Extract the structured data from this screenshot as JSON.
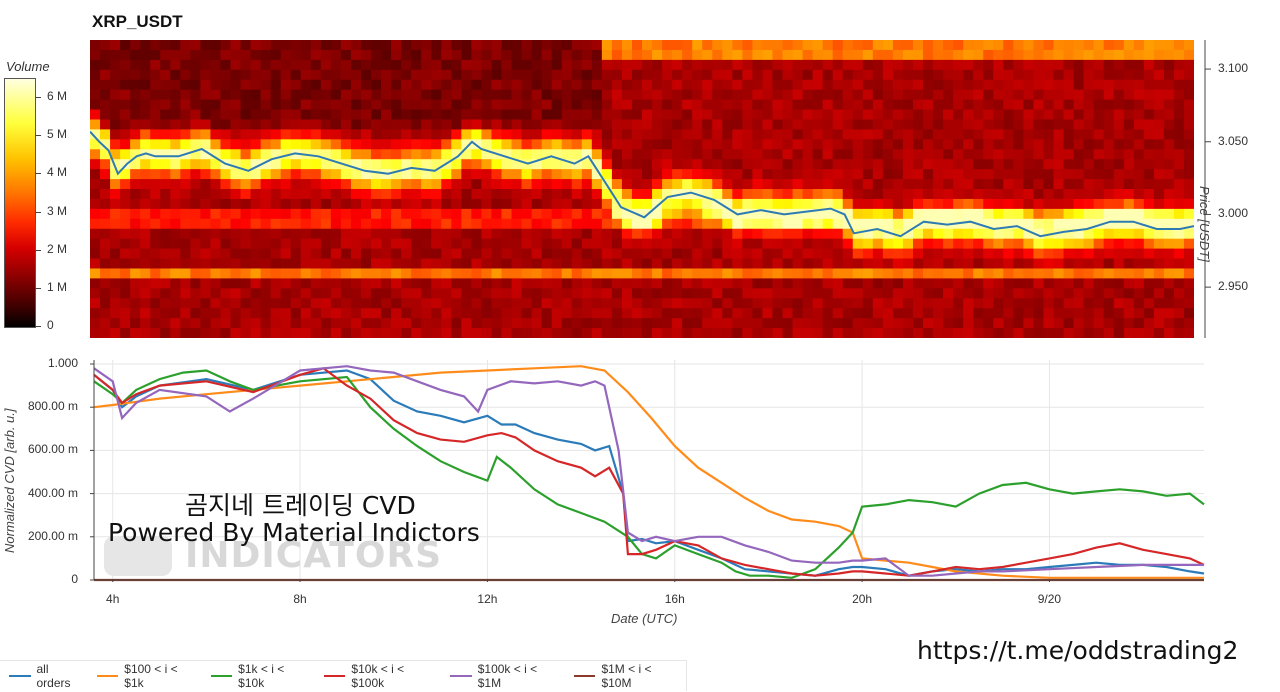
{
  "chart_data": [
    {
      "type": "heatmap",
      "title": "XRP_USDT",
      "colorbar": {
        "label": "Volume",
        "ticks": [
          "0",
          "1 M",
          "2 M",
          "3 M",
          "4 M",
          "5 M",
          "6 M"
        ],
        "range": [
          0,
          6500000
        ],
        "colormap": "hot"
      },
      "ylabel": "Price [USDT]",
      "y_ticks": [
        "2.950",
        "3.000",
        "3.050",
        "3.100"
      ],
      "y_tick_values": [
        2.95,
        3.0,
        3.05,
        3.1
      ],
      "ylim": [
        2.915,
        3.12
      ],
      "x_hours_range": [
        3.6,
        27.3
      ],
      "price_line": {
        "color": "#2e7bb4",
        "x_hours": [
          3.6,
          3.8,
          4.0,
          4.2,
          4.4,
          4.6,
          4.8,
          5.0,
          5.5,
          6.0,
          6.5,
          7.0,
          7.5,
          8.0,
          8.5,
          9.0,
          9.5,
          10.0,
          10.5,
          11.0,
          11.5,
          11.8,
          12.0,
          12.5,
          13.0,
          13.5,
          14.0,
          14.3,
          14.6,
          14.8,
          15.0,
          15.5,
          16.0,
          16.5,
          17.0,
          17.5,
          18.0,
          18.5,
          19.0,
          19.5,
          19.8,
          20.0,
          20.5,
          21.0,
          21.5,
          22.0,
          22.5,
          23.0,
          23.5,
          24.0,
          24.5,
          25.0,
          25.5,
          26.0,
          26.5,
          27.0,
          27.3
        ],
        "price": [
          3.057,
          3.05,
          3.044,
          3.028,
          3.035,
          3.04,
          3.042,
          3.04,
          3.04,
          3.045,
          3.035,
          3.03,
          3.038,
          3.042,
          3.04,
          3.035,
          3.03,
          3.028,
          3.032,
          3.03,
          3.04,
          3.05,
          3.045,
          3.04,
          3.035,
          3.04,
          3.035,
          3.04,
          3.025,
          3.015,
          3.005,
          2.998,
          3.012,
          3.015,
          3.01,
          3.0,
          3.003,
          3.0,
          3.002,
          3.004,
          3.0,
          2.987,
          2.99,
          2.985,
          2.995,
          2.993,
          2.995,
          2.99,
          2.992,
          2.985,
          2.988,
          2.99,
          2.995,
          2.995,
          2.99,
          2.99,
          2.992
        ]
      }
    },
    {
      "type": "line",
      "xlabel": "Date (UTC)",
      "ylabel": "Normalized CVD [arb. u.]",
      "x_ticks": [
        "4h",
        "8h",
        "12h",
        "16h",
        "20h",
        "9/20"
      ],
      "x_tick_hours": [
        4,
        8,
        12,
        16,
        20,
        24
      ],
      "xlim": [
        3.6,
        27.3
      ],
      "y_ticks": [
        "0",
        "200.00 m",
        "400.00 m",
        "600.00 m",
        "800.00 m",
        "1.000"
      ],
      "y_tick_values": [
        0,
        0.2,
        0.4,
        0.6,
        0.8,
        1.0
      ],
      "ylim": [
        0,
        1.0
      ],
      "grid": true,
      "legend_position": "bottom-left",
      "series": [
        {
          "name": "all orders",
          "color": "#2b7bb9",
          "x": [
            3.6,
            4.0,
            4.2,
            4.5,
            5.0,
            6.0,
            7.0,
            8.0,
            9.0,
            9.5,
            10.0,
            10.5,
            11.0,
            11.5,
            12.0,
            12.3,
            12.6,
            13.0,
            13.5,
            14.0,
            14.3,
            14.6,
            14.9,
            15.0,
            15.3,
            15.6,
            16.0,
            16.5,
            17.0,
            17.5,
            18.0,
            18.5,
            19.0,
            19.5,
            19.8,
            20.0,
            20.5,
            21.0,
            21.5,
            22.0,
            22.5,
            23.0,
            23.5,
            24.0,
            24.5,
            25.0,
            25.5,
            26.0,
            26.5,
            27.0,
            27.3
          ],
          "y": [
            0.95,
            0.88,
            0.8,
            0.85,
            0.9,
            0.93,
            0.88,
            0.95,
            0.97,
            0.93,
            0.83,
            0.78,
            0.76,
            0.73,
            0.76,
            0.72,
            0.72,
            0.68,
            0.65,
            0.63,
            0.6,
            0.62,
            0.4,
            0.18,
            0.19,
            0.17,
            0.18,
            0.14,
            0.1,
            0.05,
            0.04,
            0.03,
            0.02,
            0.05,
            0.06,
            0.06,
            0.05,
            0.02,
            0.04,
            0.05,
            0.04,
            0.05,
            0.05,
            0.06,
            0.07,
            0.08,
            0.07,
            0.07,
            0.06,
            0.04,
            0.03
          ]
        },
        {
          "name": "$100 < i < $1k",
          "color": "#ff8c1a",
          "x": [
            3.6,
            4.0,
            5.0,
            6.0,
            7.0,
            8.0,
            9.0,
            10.0,
            11.0,
            12.0,
            13.0,
            14.0,
            14.5,
            15.0,
            15.5,
            16.0,
            16.5,
            17.0,
            17.5,
            18.0,
            18.5,
            19.0,
            19.5,
            19.8,
            20.0,
            20.5,
            21.0,
            21.5,
            22.0,
            23.0,
            24.0,
            25.0,
            26.0,
            27.3
          ],
          "y": [
            0.8,
            0.81,
            0.84,
            0.86,
            0.88,
            0.9,
            0.92,
            0.94,
            0.96,
            0.97,
            0.98,
            0.99,
            0.97,
            0.87,
            0.75,
            0.62,
            0.52,
            0.45,
            0.38,
            0.32,
            0.28,
            0.27,
            0.25,
            0.22,
            0.1,
            0.09,
            0.08,
            0.06,
            0.04,
            0.02,
            0.01,
            0.01,
            0.01,
            0.01
          ]
        },
        {
          "name": "$1k < i < $10k",
          "color": "#2ca02c",
          "x": [
            3.6,
            4.0,
            4.2,
            4.5,
            5.0,
            5.5,
            6.0,
            6.5,
            7.0,
            8.0,
            9.0,
            9.5,
            10.0,
            10.5,
            11.0,
            11.5,
            12.0,
            12.2,
            12.5,
            13.0,
            13.5,
            14.0,
            14.5,
            15.0,
            15.3,
            15.6,
            16.0,
            16.5,
            17.0,
            17.3,
            17.6,
            18.0,
            18.5,
            19.0,
            19.5,
            19.8,
            20.0,
            20.5,
            21.0,
            21.5,
            22.0,
            22.5,
            23.0,
            23.5,
            24.0,
            24.5,
            25.0,
            25.5,
            26.0,
            26.5,
            27.0,
            27.3
          ],
          "y": [
            0.92,
            0.86,
            0.82,
            0.88,
            0.93,
            0.96,
            0.97,
            0.92,
            0.88,
            0.92,
            0.94,
            0.8,
            0.7,
            0.62,
            0.55,
            0.5,
            0.46,
            0.57,
            0.52,
            0.42,
            0.35,
            0.31,
            0.27,
            0.2,
            0.12,
            0.1,
            0.16,
            0.12,
            0.08,
            0.04,
            0.02,
            0.02,
            0.01,
            0.05,
            0.15,
            0.22,
            0.34,
            0.35,
            0.37,
            0.36,
            0.34,
            0.4,
            0.44,
            0.45,
            0.42,
            0.4,
            0.41,
            0.42,
            0.41,
            0.39,
            0.4,
            0.35
          ]
        },
        {
          "name": "$10k < i < $100k",
          "color": "#d62728",
          "x": [
            3.6,
            4.0,
            4.2,
            4.5,
            5.0,
            6.0,
            7.0,
            8.0,
            8.5,
            9.0,
            9.5,
            10.0,
            10.5,
            11.0,
            11.5,
            12.0,
            12.3,
            12.6,
            13.0,
            13.5,
            14.0,
            14.3,
            14.6,
            14.9,
            15.0,
            15.3,
            15.6,
            16.0,
            16.5,
            17.0,
            17.5,
            18.0,
            18.5,
            19.0,
            19.5,
            19.8,
            20.0,
            20.5,
            21.0,
            21.5,
            22.0,
            22.5,
            23.0,
            23.5,
            24.0,
            24.5,
            25.0,
            25.5,
            26.0,
            26.5,
            27.0,
            27.3
          ],
          "y": [
            0.95,
            0.88,
            0.82,
            0.86,
            0.9,
            0.92,
            0.87,
            0.95,
            0.98,
            0.9,
            0.84,
            0.74,
            0.68,
            0.65,
            0.64,
            0.67,
            0.68,
            0.66,
            0.6,
            0.55,
            0.52,
            0.48,
            0.52,
            0.4,
            0.12,
            0.12,
            0.14,
            0.18,
            0.16,
            0.1,
            0.07,
            0.05,
            0.03,
            0.02,
            0.03,
            0.04,
            0.04,
            0.03,
            0.02,
            0.04,
            0.06,
            0.05,
            0.06,
            0.08,
            0.1,
            0.12,
            0.15,
            0.17,
            0.14,
            0.12,
            0.1,
            0.07
          ]
        },
        {
          "name": "$100k < i < $1M",
          "color": "#9467bd",
          "x": [
            3.6,
            4.0,
            4.2,
            4.5,
            5.0,
            6.0,
            6.5,
            7.0,
            8.0,
            9.0,
            9.5,
            10.0,
            10.5,
            11.0,
            11.5,
            11.8,
            12.0,
            12.5,
            13.0,
            13.5,
            14.0,
            14.3,
            14.5,
            14.8,
            15.0,
            15.3,
            15.6,
            16.0,
            16.5,
            17.0,
            17.5,
            18.0,
            18.5,
            19.0,
            19.5,
            19.8,
            20.0,
            20.5,
            21.0,
            21.5,
            22.0,
            22.5,
            23.0,
            24.0,
            25.0,
            26.0,
            27.3
          ],
          "y": [
            0.98,
            0.92,
            0.75,
            0.82,
            0.88,
            0.85,
            0.78,
            0.84,
            0.97,
            0.99,
            0.97,
            0.96,
            0.92,
            0.88,
            0.85,
            0.78,
            0.88,
            0.92,
            0.91,
            0.92,
            0.9,
            0.92,
            0.9,
            0.6,
            0.22,
            0.18,
            0.2,
            0.18,
            0.2,
            0.2,
            0.16,
            0.13,
            0.09,
            0.08,
            0.08,
            0.09,
            0.09,
            0.1,
            0.02,
            0.02,
            0.03,
            0.04,
            0.04,
            0.05,
            0.06,
            0.07,
            0.07
          ]
        },
        {
          "name": "$1M < i < $10M",
          "color": "#8c3b2a",
          "x": [
            3.6,
            27.3
          ],
          "y": [
            0,
            0
          ]
        }
      ]
    }
  ],
  "overlay": {
    "line1": "곰지네 트레이딩 CVD",
    "line2": "Powered By Material Indictors",
    "watermark": "INDICATORS",
    "link": "https://t.me/oddstrading2"
  }
}
